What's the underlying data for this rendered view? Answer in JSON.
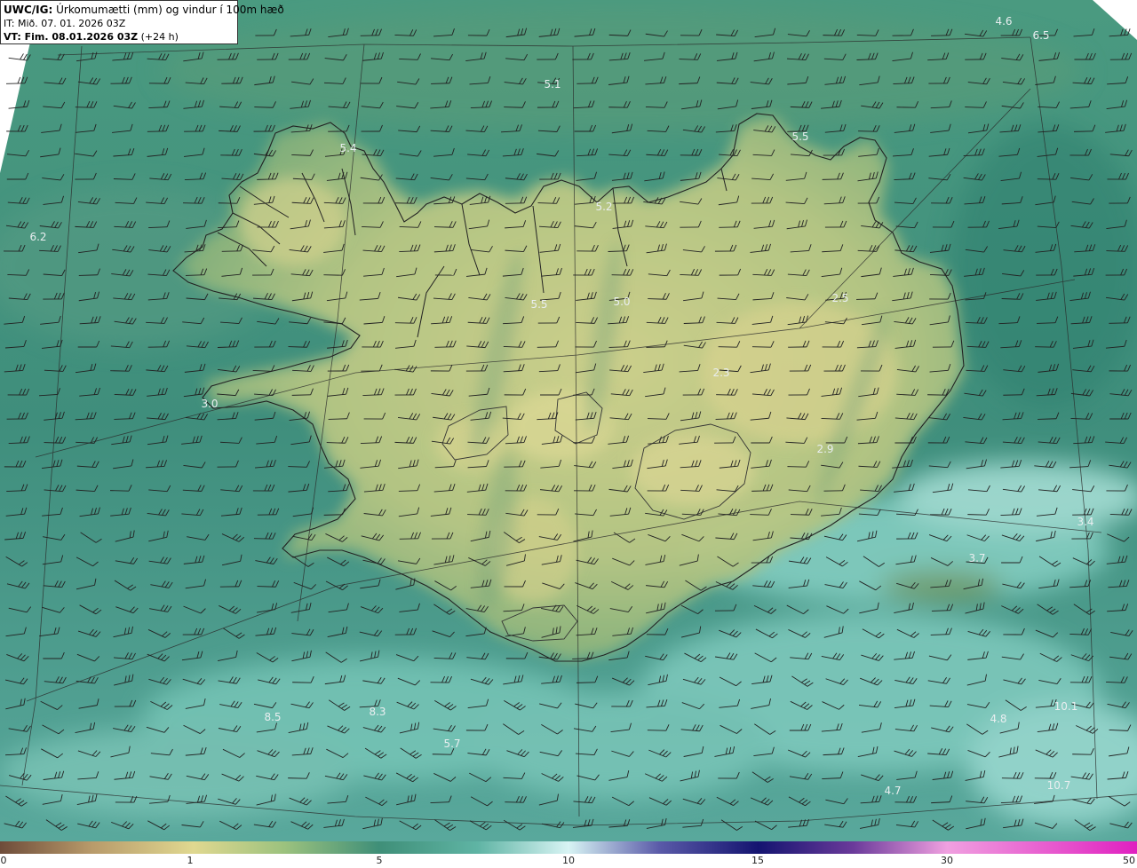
{
  "header": {
    "product": "UWC/IG:",
    "description": "Úrkomumætti (mm) og vindur í 100m hæð",
    "initial_time": "IT: Mið. 07. 01. 2026 03Z",
    "valid_prefix": "VT: Fim. 08.01.2026 03Z",
    "valid_suffix": "(+24 h)"
  },
  "value_labels": [
    {
      "text": "4.6"
    },
    {
      "text": "6.5"
    },
    {
      "text": "5.1"
    },
    {
      "text": "5.5"
    },
    {
      "text": "5.4"
    },
    {
      "text": "5.2"
    },
    {
      "text": "6.2"
    },
    {
      "text": "5.5"
    },
    {
      "text": "5.0"
    },
    {
      "text": "2.5"
    },
    {
      "text": "2.3"
    },
    {
      "text": "3.0"
    },
    {
      "text": "2.9"
    },
    {
      "text": "3.4"
    },
    {
      "text": "3.7"
    },
    {
      "text": "8.5"
    },
    {
      "text": "8.3"
    },
    {
      "text": "5.7"
    },
    {
      "text": "4.8"
    },
    {
      "text": "10.1"
    },
    {
      "text": "4.7"
    },
    {
      "text": "10.7"
    }
  ],
  "colorbar": {
    "labels": [
      "0",
      "1",
      "5",
      "10",
      "15",
      "30",
      "50"
    ],
    "colors": [
      "#6e4c3a",
      "#b89a6a",
      "#e0d890",
      "#3f8f78",
      "#2f7a68",
      "#7fd4d4",
      "#d8f4f4",
      "#5a5aa8",
      "#141470",
      "#6a3a9a",
      "#c060c0",
      "#f0a0e0",
      "#e020c0"
    ]
  },
  "map_colors": {
    "ocean": "#3e8a78",
    "ocean_light": "#6fc2b4",
    "land": "#c8cd8a",
    "land_dark": "#8db07a",
    "coast": "#222222",
    "barb": "#222222",
    "grid": "#2a2a2a"
  }
}
